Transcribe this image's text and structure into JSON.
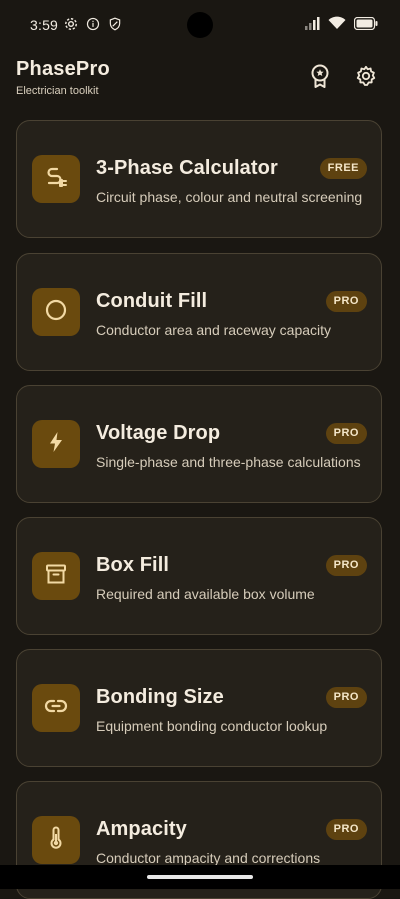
{
  "status_bar": {
    "time": "3:59",
    "left_icons": [
      "gear-icon",
      "info-icon",
      "shield-icon"
    ],
    "right_icons": [
      "signal-icon",
      "wifi-icon",
      "battery-icon"
    ]
  },
  "header": {
    "title": "PhasePro",
    "subtitle": "Electrician toolkit",
    "actions": [
      "award-icon",
      "settings-icon"
    ]
  },
  "tools": [
    {
      "name": "3-Phase Calculator",
      "description": "Circuit phase, colour and neutral screening",
      "badge": "FREE",
      "icon": "plug-icon"
    },
    {
      "name": "Conduit Fill",
      "description": "Conductor area and raceway capacity",
      "badge": "PRO",
      "icon": "circle-icon"
    },
    {
      "name": "Voltage Drop",
      "description": "Single-phase and three-phase calculations",
      "badge": "PRO",
      "icon": "bolt-icon"
    },
    {
      "name": "Box Fill",
      "description": "Required and available box volume",
      "badge": "PRO",
      "icon": "archive-box-icon"
    },
    {
      "name": "Bonding Size",
      "description": "Equipment bonding conductor lookup",
      "badge": "PRO",
      "icon": "link-icon"
    },
    {
      "name": "Ampacity",
      "description": "Conductor ampacity and corrections",
      "badge": "PRO",
      "icon": "thermometer-icon"
    }
  ],
  "colors": {
    "background": "#1a1712",
    "card": "#25211a",
    "card_border": "#4a4233",
    "icon_tile": "#6a4a0e",
    "badge": "#5e4210",
    "accent": "#f0c05a"
  }
}
